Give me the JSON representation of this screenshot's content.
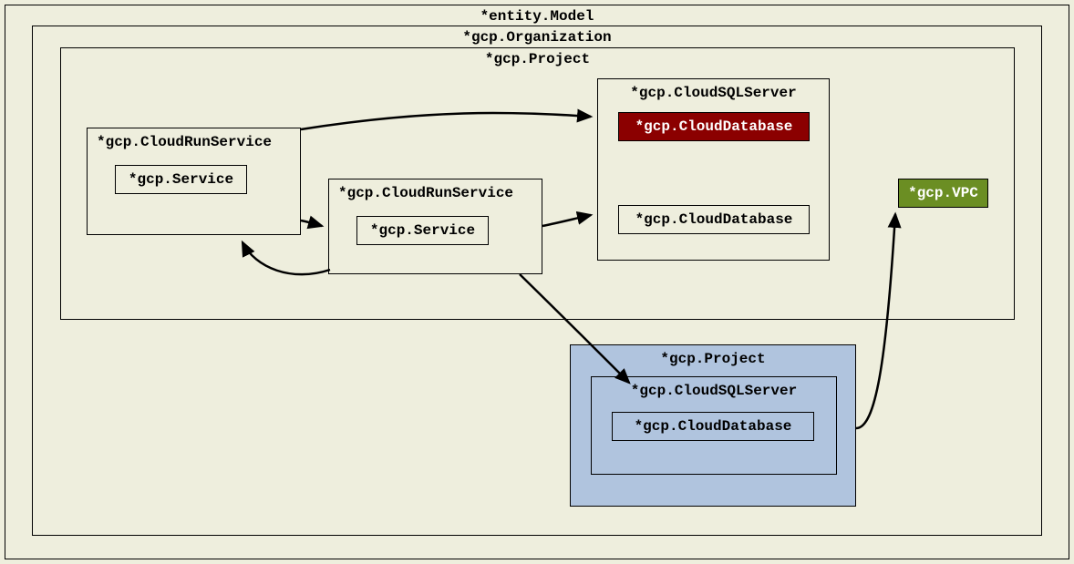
{
  "entityModel": {
    "label": "*entity.Model"
  },
  "organization": {
    "label": "*gcp.Organization"
  },
  "project1": {
    "label": "*gcp.Project"
  },
  "cloudRun1": {
    "label": "*gcp.CloudRunService",
    "service": "*gcp.Service"
  },
  "cloudRun2": {
    "label": "*gcp.CloudRunService",
    "service": "*gcp.Service"
  },
  "sqlServer1": {
    "label": "*gcp.CloudSQLServer",
    "db1": "*gcp.CloudDatabase",
    "db2": "*gcp.CloudDatabase"
  },
  "vpc": {
    "label": "*gcp.VPC"
  },
  "project2": {
    "label": "*gcp.Project",
    "sqlServer": "*gcp.CloudSQLServer",
    "db": "*gcp.CloudDatabase"
  }
}
